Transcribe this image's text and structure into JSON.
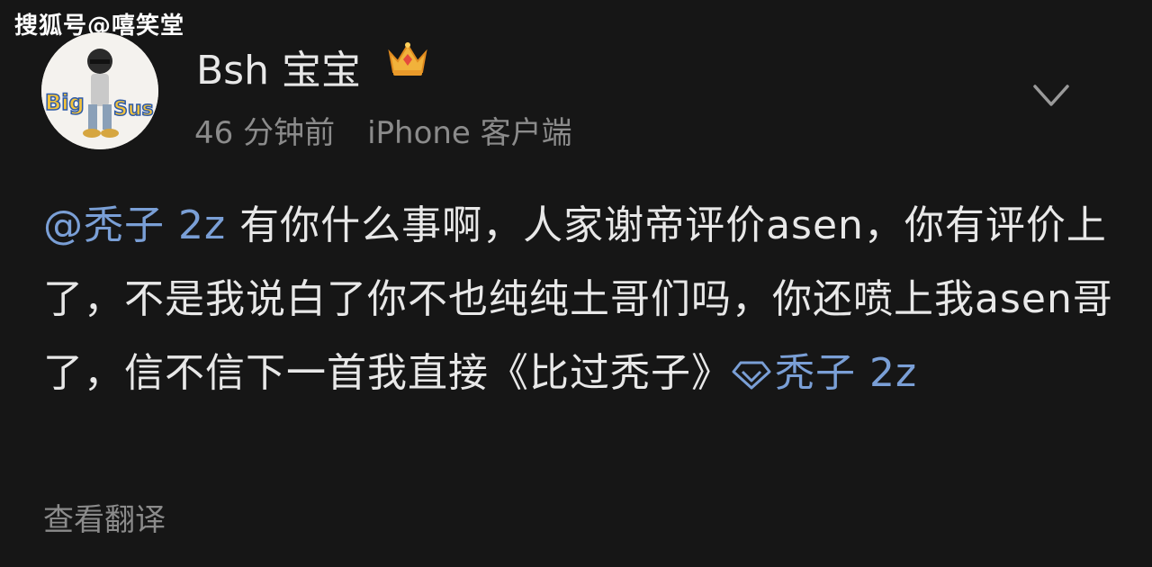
{
  "watermark": "搜狐号@嘻笑堂",
  "post": {
    "username": "Bsh 宝宝",
    "time": "46 分钟前",
    "client": "iPhone 客户端",
    "mention": "@秃子 2z",
    "text": " 有你什么事啊，人家谢帝评价asen，你有评价上了，不是我说白了你不也纯纯土哥们吗，你还喷上我asen哥了，信不信下一首我直接《比过秃子》",
    "topic_link": "秃子 2z",
    "translate_label": "查看翻译"
  },
  "avatar_text": {
    "left": "Big",
    "right": "Sus"
  },
  "icons": {
    "avatar": "avatar-icon",
    "crown": "crown-badge-icon",
    "chevron": "chevron-down-icon",
    "link": "diamond-link-icon"
  },
  "colors": {
    "background": "#161616",
    "text": "#e8e8e8",
    "muted": "#8b8b8b",
    "link": "#7a9fd6"
  }
}
